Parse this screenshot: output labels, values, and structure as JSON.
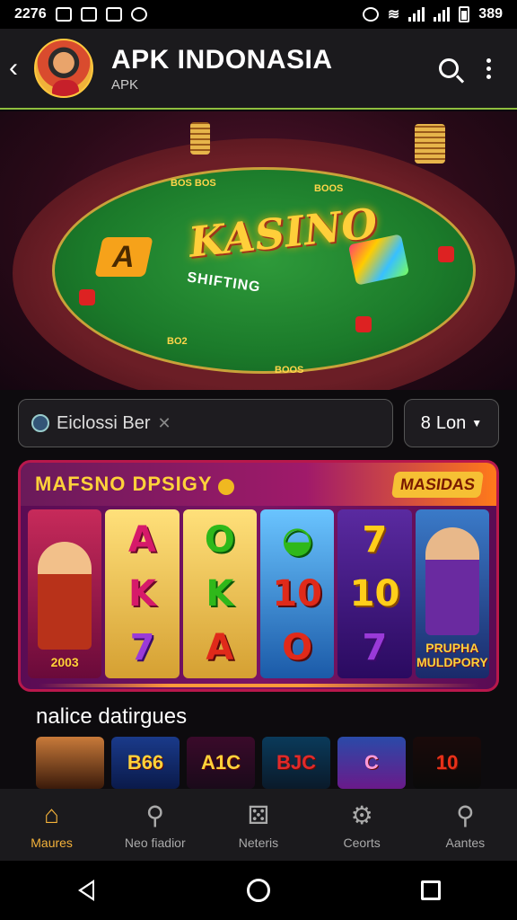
{
  "status_bar": {
    "time": "2276",
    "right_value": "389"
  },
  "header": {
    "title": "APK INDONASIA",
    "subtitle": "APK"
  },
  "hero": {
    "logo_text": "KASINO",
    "subtitle_text": "SHIFTING",
    "card_label": "A",
    "table_labels": [
      "BOS BOS",
      "BOOS",
      "BO2",
      "BOOS"
    ]
  },
  "search": {
    "value": "Eiclossi Ber",
    "language_label": "Lon"
  },
  "slots_banner": {
    "title": "MAFSNO DPSIGY",
    "badge": "MASIDAS",
    "reels": [
      {
        "caption": "2003"
      },
      {
        "symbols": [
          "A",
          "K",
          "7"
        ]
      },
      {
        "symbols": [
          "O",
          "K",
          "A"
        ]
      },
      {
        "symbols": [
          "",
          "10",
          "O"
        ]
      },
      {
        "symbols": [
          "7",
          "10",
          "7"
        ]
      },
      {
        "caption": "PRUPHA MULDPORY"
      }
    ]
  },
  "section": {
    "title": "nalice datirgues"
  },
  "games": [
    "",
    "B66",
    "A1C",
    "BJC",
    "C",
    "10"
  ],
  "bottom_nav": [
    {
      "label": "Maures",
      "icon": "home-icon"
    },
    {
      "label": "Neo fiadior",
      "icon": "search-icon"
    },
    {
      "label": "Neteris",
      "icon": "dice-icon"
    },
    {
      "label": "Ceorts",
      "icon": "settings-icon"
    },
    {
      "label": "Aantes",
      "icon": "search-icon"
    }
  ],
  "colors": {
    "accent": "#f4b23a",
    "header_bg": "#1b1a1d",
    "header_border": "#8fbf3f",
    "banner_border": "#b8184c"
  }
}
